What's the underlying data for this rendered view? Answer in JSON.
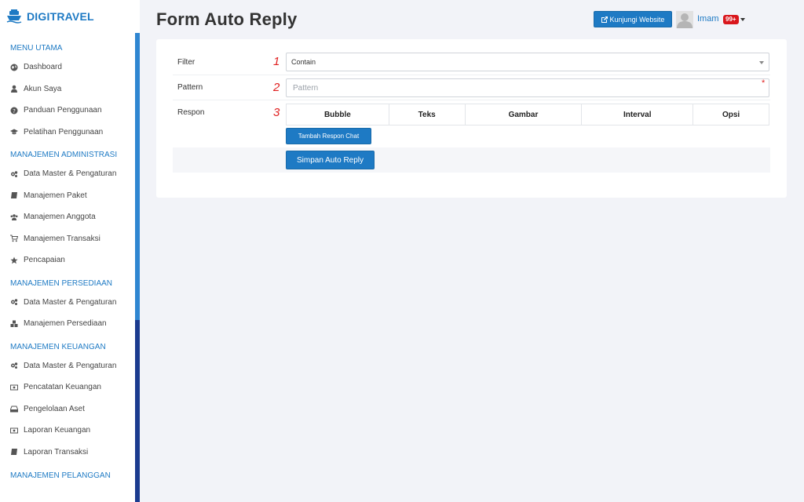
{
  "brand": {
    "name": "DIGITRAVEL",
    "icon": "cruise-ship-icon"
  },
  "sidebar": {
    "sections": [
      {
        "title": "MENU UTAMA",
        "items": [
          {
            "label": "Dashboard",
            "icon": "globe-icon"
          },
          {
            "label": "Akun Saya",
            "icon": "user-icon"
          },
          {
            "label": "Panduan Penggunaan",
            "icon": "question-circle-icon"
          },
          {
            "label": "Pelatihan Penggunaan",
            "icon": "graduation-cap-icon"
          }
        ]
      },
      {
        "title": "MANAJEMEN ADMINISTRASI",
        "items": [
          {
            "label": "Data Master & Pengaturan",
            "icon": "cogs-icon"
          },
          {
            "label": "Manajemen Paket",
            "icon": "book-icon"
          },
          {
            "label": "Manajemen Anggota",
            "icon": "users-icon"
          },
          {
            "label": "Manajemen Transaksi",
            "icon": "cart-icon"
          },
          {
            "label": "Pencapaian",
            "icon": "star-icon"
          }
        ]
      },
      {
        "title": "MANAJEMEN PERSEDIAAN",
        "items": [
          {
            "label": "Data Master & Pengaturan",
            "icon": "cogs-icon"
          },
          {
            "label": "Manajemen Persediaan",
            "icon": "cubes-icon"
          }
        ]
      },
      {
        "title": "MANAJEMEN KEUANGAN",
        "items": [
          {
            "label": "Data Master & Pengaturan",
            "icon": "cogs-icon"
          },
          {
            "label": "Pencatatan Keuangan",
            "icon": "money-icon"
          },
          {
            "label": "Pengelolaan Aset",
            "icon": "hdd-icon"
          },
          {
            "label": "Laporan Keuangan",
            "icon": "money-icon"
          },
          {
            "label": "Laporan Transaksi",
            "icon": "book-icon"
          }
        ]
      }
    ],
    "partial_section_title": "MANAJEMEN PELANGGAN"
  },
  "header": {
    "title": "Form Auto Reply",
    "visit_button": "Kunjungi Website",
    "user_name": "Imam",
    "badge": "99+"
  },
  "form": {
    "filter": {
      "label": "Filter",
      "number": "1",
      "value": "Contain"
    },
    "pattern": {
      "label": "Pattern",
      "number": "2",
      "placeholder": "Pattern",
      "required_mark": "*"
    },
    "respon": {
      "label": "Respon",
      "number": "3",
      "columns": [
        "Bubble",
        "Teks",
        "Gambar",
        "Interval",
        "Opsi"
      ],
      "add_button": "Tambah Respon Chat"
    },
    "save_button": "Simpan Auto Reply"
  },
  "colors": {
    "accent": "#1e7ac4",
    "badge": "#d9161c",
    "marker": "#e02020"
  }
}
